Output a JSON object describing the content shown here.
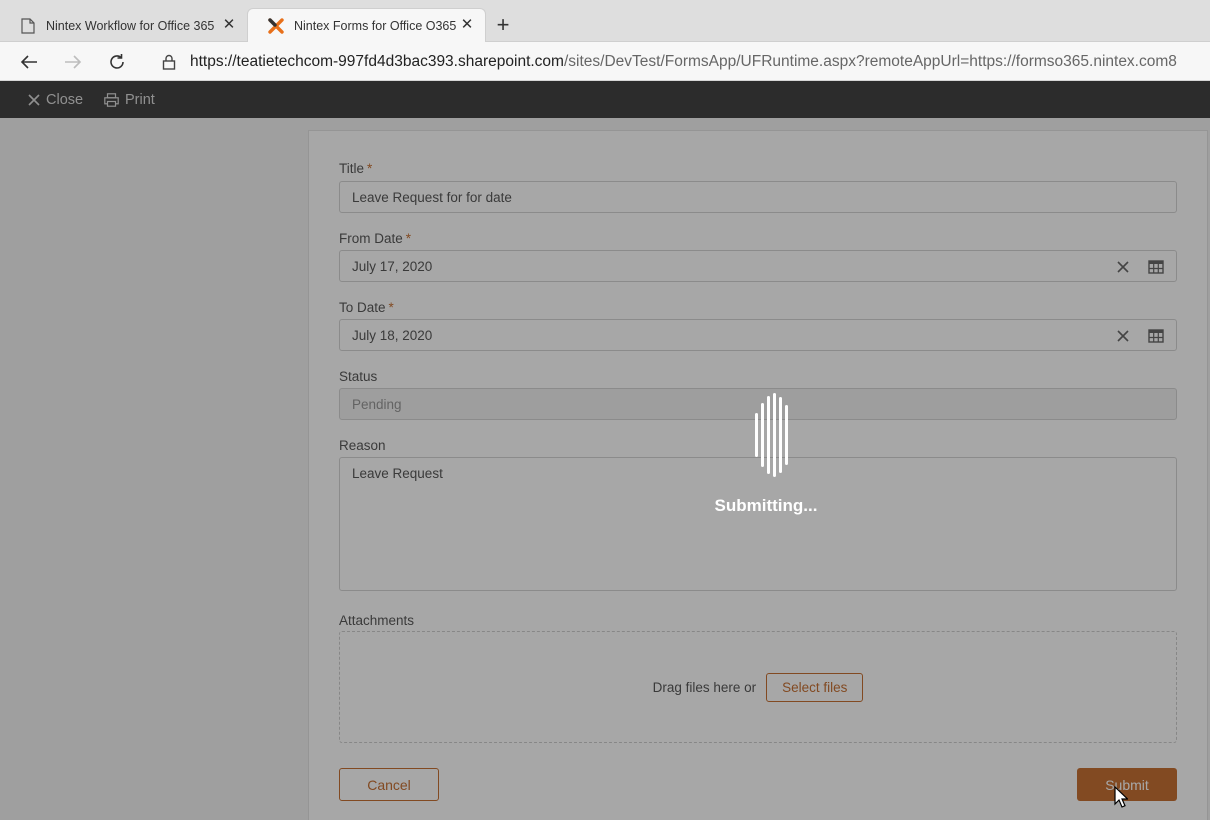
{
  "browser": {
    "tabs": [
      {
        "title": "Nintex Workflow for Office 365",
        "close": "✕"
      },
      {
        "title": "Nintex Forms for Office O365",
        "close": "✕"
      }
    ],
    "new_tab": "+",
    "url_host": "https://teatietechcom-997fd4d3bac393.sharepoint.com",
    "url_path": "/sites/DevTest/FormsApp/UFRuntime.aspx?remoteAppUrl=https://formso365.nintex.com8"
  },
  "appbar": {
    "close_label": "Close",
    "print_label": "Print"
  },
  "form": {
    "title_label": "Title",
    "title_value": "Leave Request for  for date",
    "from_label": "From Date",
    "from_value": "July 17, 2020",
    "to_label": "To Date",
    "to_value": "July 18, 2020",
    "status_label": "Status",
    "status_value": "Pending",
    "reason_label": "Reason",
    "reason_value": "Leave Request",
    "attachments_label": "Attachments",
    "drag_text": "Drag files here or",
    "select_files_label": "Select files",
    "required_mark": "*",
    "cancel_label": "Cancel",
    "submit_label": "Submit"
  },
  "overlay": {
    "message": "Submitting..."
  },
  "colors": {
    "accent": "#c0601b",
    "appbar": "#2b2b2b"
  }
}
